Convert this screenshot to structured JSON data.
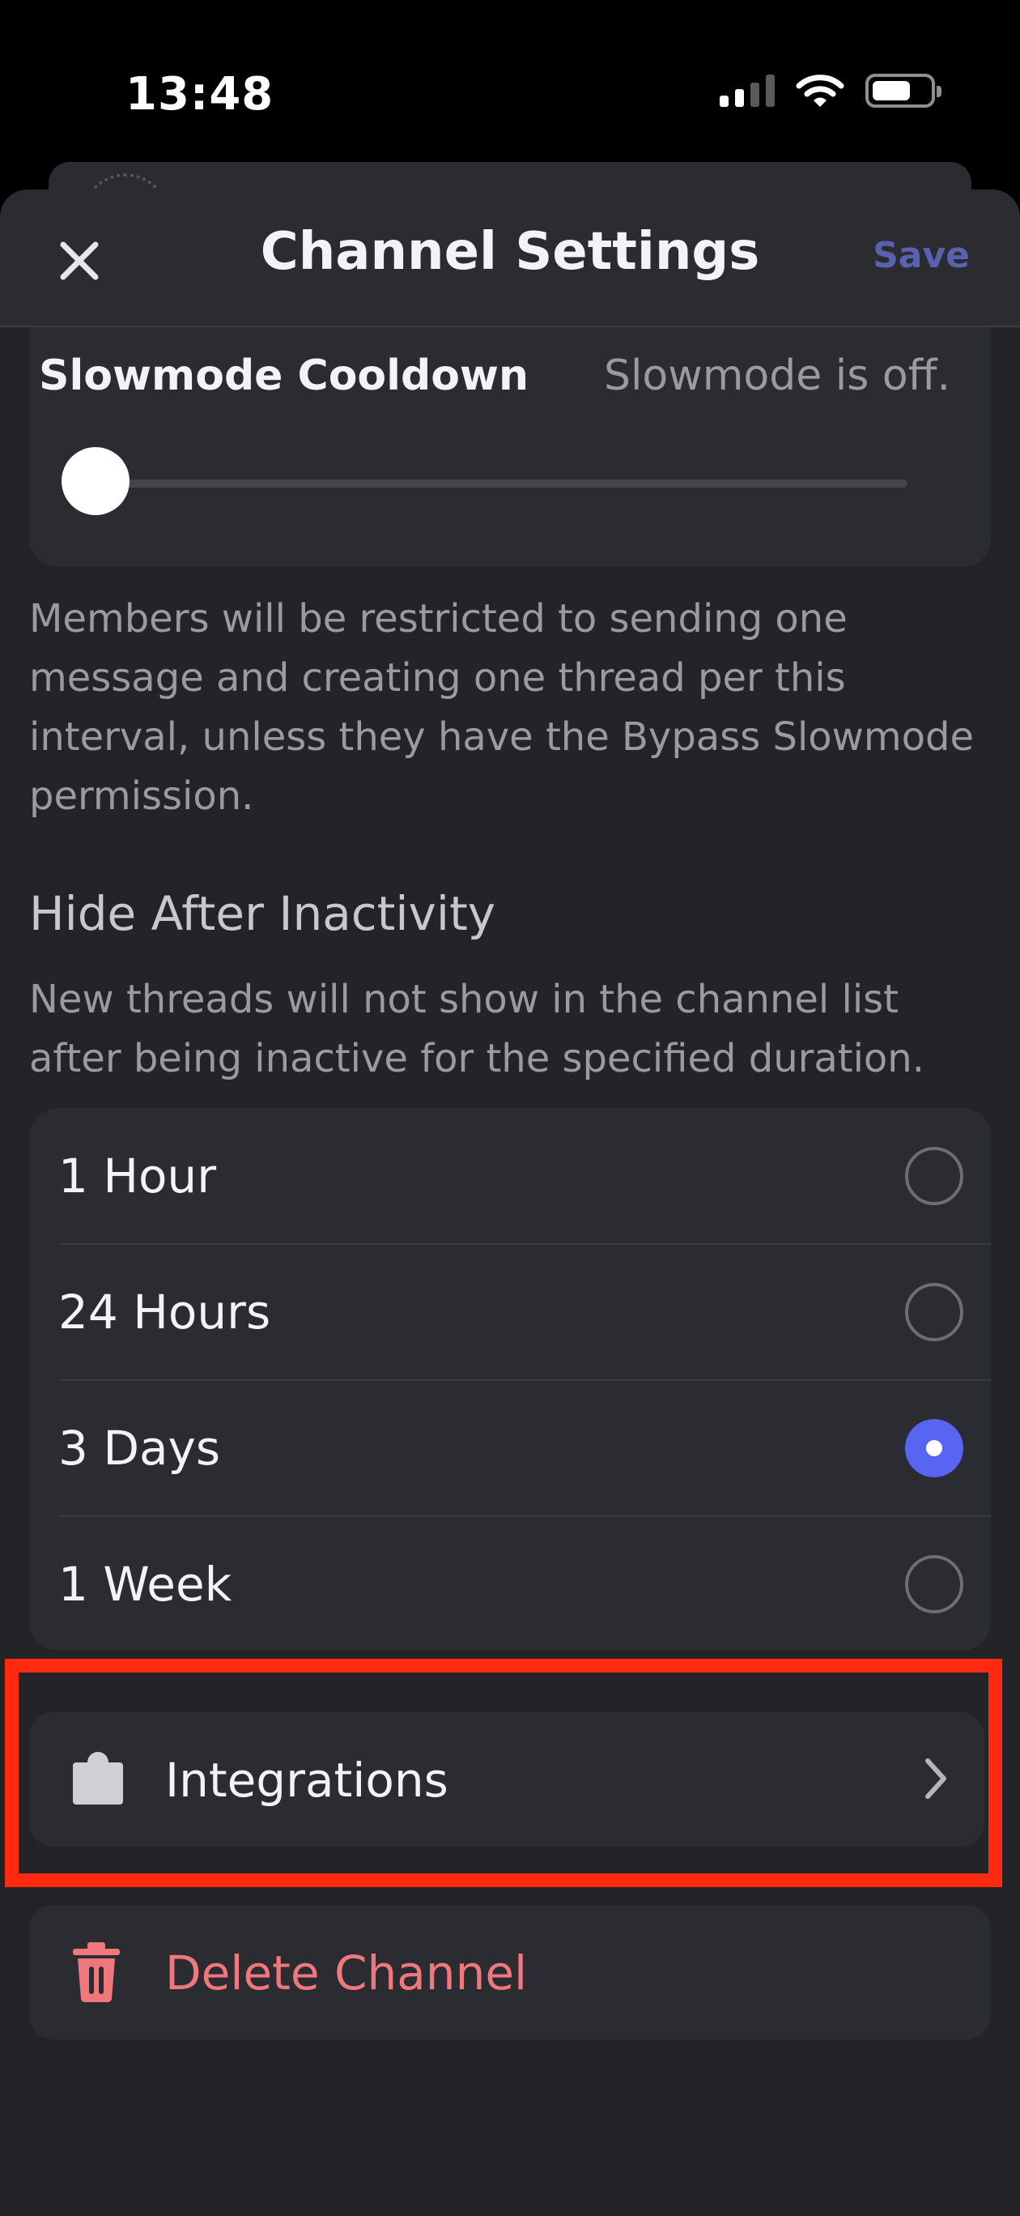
{
  "status_bar": {
    "time": "13:48",
    "icons": [
      "cellular-signal-icon",
      "wifi-icon",
      "battery-icon"
    ]
  },
  "header": {
    "title": "Channel Settings",
    "save_label": "Save",
    "close_icon": "close-icon"
  },
  "slowmode": {
    "label": "Slowmode Cooldown",
    "value": "Slowmode is off.",
    "slider_fraction": 0
  },
  "slowmode_help": "Members will be restricted to sending one message and creating one thread per this interval, unless they have the Bypass Slowmode permission.",
  "hide_after_inactivity": {
    "title": "Hide After Inactivity",
    "description": "New threads will not show in the channel list after being inactive for the specified duration.",
    "options": [
      {
        "label": "1 Hour",
        "selected": false
      },
      {
        "label": "24 Hours",
        "selected": false
      },
      {
        "label": "3 Days",
        "selected": true
      },
      {
        "label": "1 Week",
        "selected": false
      }
    ]
  },
  "integrations": {
    "label": "Integrations",
    "icon": "puzzle-icon"
  },
  "delete_channel": {
    "label": "Delete Channel",
    "icon": "trash-icon"
  },
  "colors": {
    "accent": "#5865f2",
    "danger": "#f0777c",
    "highlight": "#ff2a10",
    "background": "#232328",
    "card": "#2b2c31"
  }
}
